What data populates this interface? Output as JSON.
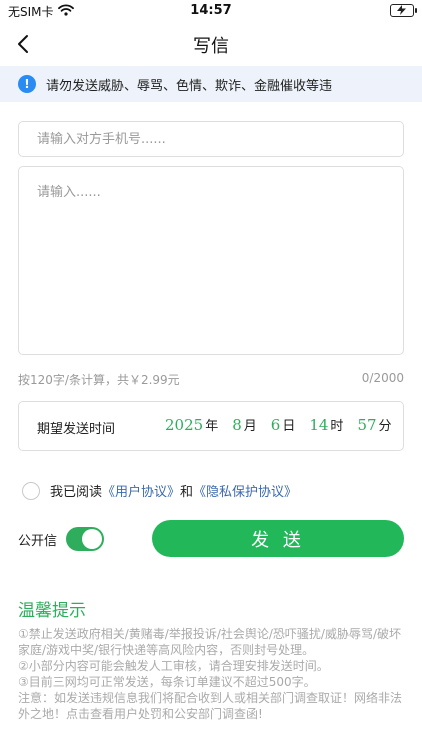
{
  "status_bar": {
    "carrier": "无SIM卡",
    "time": "14:57"
  },
  "nav": {
    "title": "写信"
  },
  "notice": {
    "text": "请勿发送威胁、辱骂、色情、欺诈、金融催收等违"
  },
  "form": {
    "phone_placeholder": "请输入对方手机号......",
    "message_placeholder": "请输入......",
    "price_note": "按120字/条计算，共￥2.99元",
    "counter": "0/2000"
  },
  "send_time": {
    "label": "期望发送时间",
    "year": "2025",
    "year_unit": "年",
    "month": "8",
    "month_unit": "月",
    "day": "6",
    "day_unit": "日",
    "hour": "14",
    "hour_unit": "时",
    "minute": "57",
    "minute_unit": "分"
  },
  "agreement": {
    "prefix": "我已阅读",
    "user_agreement": "《用户协议》",
    "and": "和",
    "privacy_agreement": "《隐私保护协议》",
    "checked": false
  },
  "actions": {
    "public_label": "公开信",
    "public_on": true,
    "send_label": "发 送"
  },
  "tips": {
    "title": "温馨提示",
    "lines": [
      "①禁止发送政府相关/黄赌毒/举报投诉/社会舆论/恐吓骚扰/威胁辱骂/破坏家庭/游戏中奖/银行快递等高风险内容，否则封号处理。",
      "②小部分内容可能会触发人工审核，请合理安排发送时间。",
      "③目前三网均可正常发送，每条订单建议不超过500字。",
      "注意：如发送违规信息我们将配合收到人或相关部门调查取证！网络非法外之地！点击查看用户处罚和公安部门调查函!"
    ]
  },
  "colors": {
    "accent_green": "#22b85a",
    "link_blue": "#3b6ab0",
    "notice_bg": "#eef3fb",
    "info_icon": "#2a8bf2"
  }
}
